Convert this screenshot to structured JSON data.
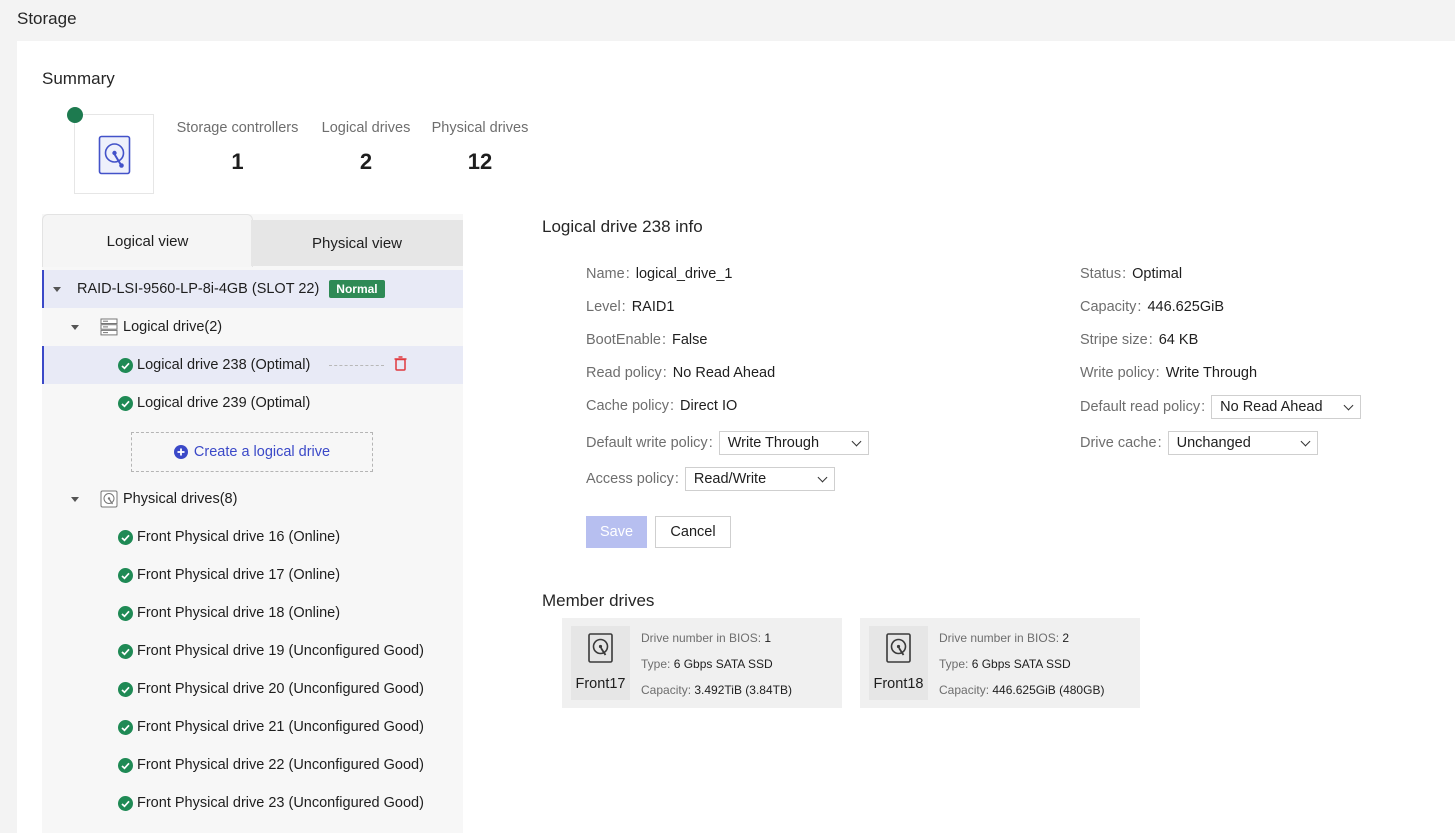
{
  "page_title": "Storage",
  "summary": {
    "title": "Summary",
    "stats": [
      {
        "label": "Storage controllers",
        "value": "1"
      },
      {
        "label": "Logical drives",
        "value": "2"
      },
      {
        "label": "Physical drives",
        "value": "12"
      }
    ]
  },
  "tabs": {
    "logical": "Logical view",
    "physical": "Physical view"
  },
  "tree": {
    "controller": {
      "name": "RAID-LSI-9560-LP-8i-4GB (SLOT 22)",
      "badge": "Normal"
    },
    "logical_group": "Logical drive(2)",
    "logical_drives": [
      "Logical drive 238 (Optimal)",
      "Logical drive 239 (Optimal)"
    ],
    "create_label": "Create a logical drive",
    "physical_group": "Physical drives(8)",
    "physical_drives": [
      "Front Physical drive 16 (Online)",
      "Front Physical drive 17 (Online)",
      "Front Physical drive 18 (Online)",
      "Front Physical drive 19 (Unconfigured Good)",
      "Front Physical drive 20 (Unconfigured Good)",
      "Front Physical drive 21 (Unconfigured Good)",
      "Front Physical drive 22 (Unconfigured Good)",
      "Front Physical drive 23 (Unconfigured Good)"
    ]
  },
  "info": {
    "title": "Logical drive 238 info",
    "colon": ":",
    "name": {
      "label": "Name",
      "value": "logical_drive_1"
    },
    "level": {
      "label": "Level",
      "value": "RAID1"
    },
    "boot": {
      "label": "BootEnable",
      "value": "False"
    },
    "read_policy": {
      "label": "Read policy",
      "value": "No Read Ahead"
    },
    "cache_policy": {
      "label": "Cache policy",
      "value": "Direct IO"
    },
    "default_write": {
      "label": "Default write policy",
      "value": "Write Through"
    },
    "access": {
      "label": "Access policy",
      "value": "Read/Write"
    },
    "status": {
      "label": "Status",
      "value": "Optimal"
    },
    "capacity": {
      "label": "Capacity",
      "value": "446.625GiB"
    },
    "stripe": {
      "label": "Stripe size",
      "value": "64 KB"
    },
    "write_policy": {
      "label": "Write policy",
      "value": "Write Through"
    },
    "default_read": {
      "label": "Default read policy",
      "value": "No Read Ahead"
    },
    "drive_cache": {
      "label": "Drive cache",
      "value": "Unchanged"
    }
  },
  "buttons": {
    "save": "Save",
    "cancel": "Cancel"
  },
  "member": {
    "title": "Member drives",
    "labels": {
      "bios": "Drive number in BIOS",
      "type": "Type",
      "capacity": "Capacity"
    },
    "drives": [
      {
        "name": "Front17",
        "bios": "1",
        "type": "6 Gbps SATA SSD",
        "capacity": "3.492TiB (3.84TB)"
      },
      {
        "name": "Front18",
        "bios": "2",
        "type": "6 Gbps SATA SSD",
        "capacity": "446.625GiB (480GB)"
      }
    ]
  },
  "colors": {
    "accent": "#3b49c8",
    "ok_green": "#1f8a55",
    "badge_green": "#2e8a55",
    "save_disabled": "#b7bff0",
    "delete_red": "#e0393e"
  }
}
